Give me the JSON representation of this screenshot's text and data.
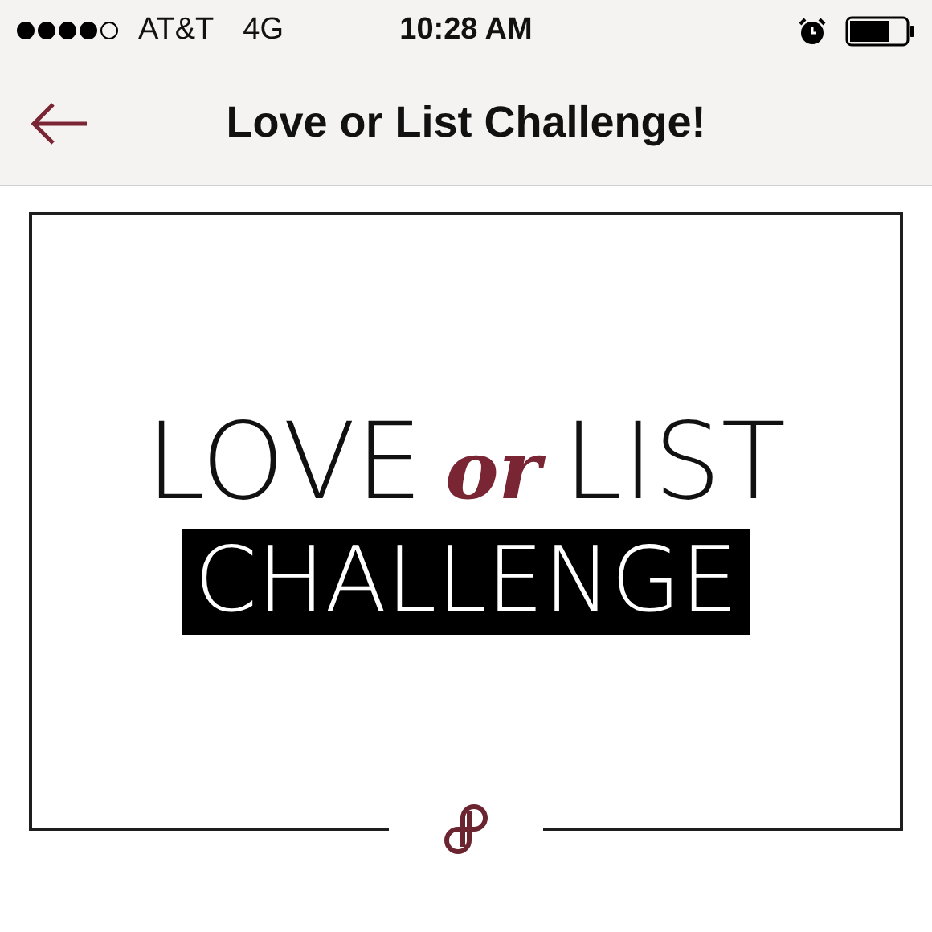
{
  "status_bar": {
    "carrier": "AT&T",
    "network": "4G",
    "time": "10:28 AM"
  },
  "nav": {
    "title": "Love or List Challenge!"
  },
  "banner": {
    "line_1_start": "LOVE",
    "line_1_middle": "or",
    "line_1_end": "LIST",
    "line_2": "CHALLENGE"
  }
}
